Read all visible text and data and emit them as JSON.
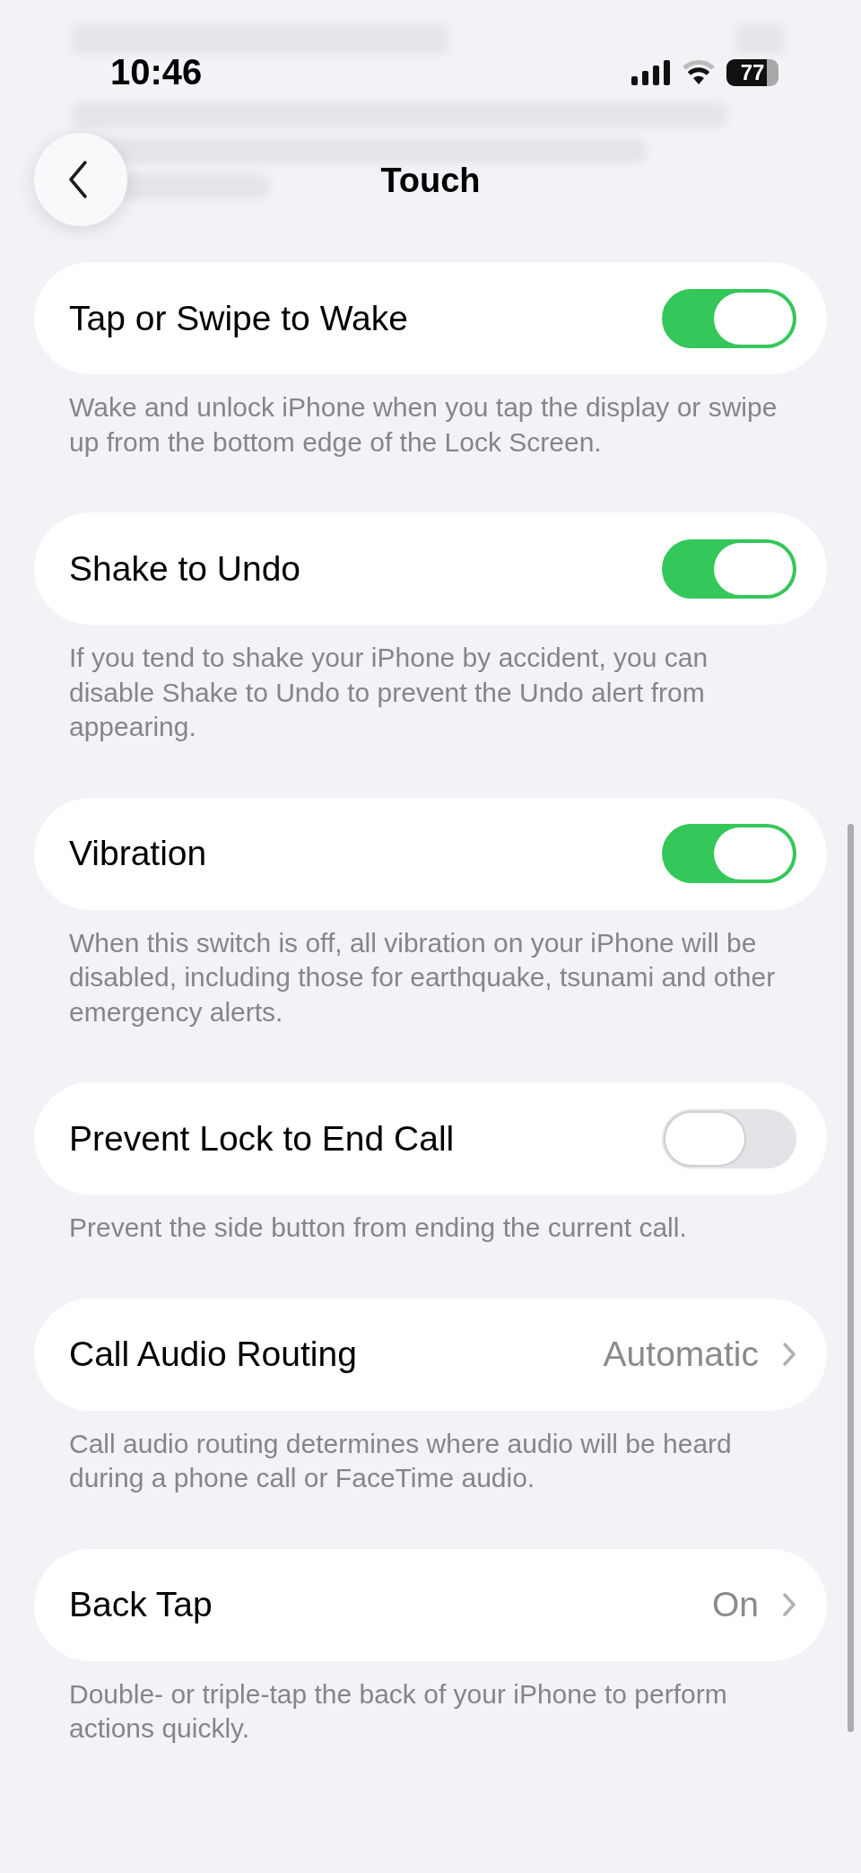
{
  "status_bar": {
    "time": "10:46",
    "battery": "77"
  },
  "nav": {
    "title": "Touch"
  },
  "rows": [
    {
      "kind": "toggle",
      "label": "Tap or Swipe to Wake",
      "on": true,
      "footer": "Wake and unlock iPhone when you tap the display or swipe up from the bottom edge of the Lock Screen."
    },
    {
      "kind": "toggle",
      "label": "Shake to Undo",
      "on": true,
      "footer": "If you tend to shake your iPhone by accident, you can disable Shake to Undo to prevent the Undo alert from appearing."
    },
    {
      "kind": "toggle",
      "label": "Vibration",
      "on": true,
      "footer": "When this switch is off, all vibration on your iPhone will be disabled, including those for earthquake, tsunami and other emergency alerts."
    },
    {
      "kind": "toggle",
      "label": "Prevent Lock to End Call",
      "on": false,
      "footer": "Prevent the side button from ending the current call."
    },
    {
      "kind": "link",
      "label": "Call Audio Routing",
      "value": "Automatic",
      "footer": "Call audio routing determines where audio will be heard during a phone call or FaceTime audio."
    },
    {
      "kind": "link",
      "label": "Back Tap",
      "value": "On",
      "footer": "Double- or triple-tap the back of your iPhone to perform actions quickly."
    }
  ]
}
